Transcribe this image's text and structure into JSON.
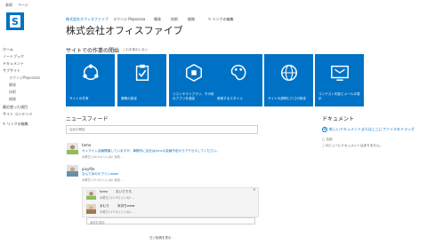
{
  "topbar": {
    "links": [
      "参照",
      "ページ"
    ]
  },
  "logo": {
    "letter": "S"
  },
  "header_nav": [
    {
      "label": "株式会社オフィスファイブ",
      "active": true
    },
    {
      "label": "ラウンジ Pepocoza",
      "active": false
    },
    {
      "label": "開発",
      "active": false
    },
    {
      "label": "技術",
      "active": false
    },
    {
      "label": "総務",
      "active": false
    },
    {
      "label": "リンクの編集",
      "active": false
    }
  ],
  "site_title": "株式会社オフィスファイブ",
  "left_nav": [
    {
      "label": "ホーム",
      "indent": false
    },
    {
      "label": "ノートブック",
      "indent": false
    },
    {
      "label": "ドキュメント",
      "indent": false
    },
    {
      "label": "サブサイト",
      "indent": false
    },
    {
      "label": "ラウンジPepocoza",
      "indent": true
    },
    {
      "label": "開発",
      "indent": true
    },
    {
      "label": "技術",
      "indent": true
    },
    {
      "label": "総務",
      "indent": true
    },
    {
      "label": "最近使った項目",
      "indent": false
    },
    {
      "label": "サイト コンテンツ",
      "indent": false
    },
    {
      "label": "リンクの編集",
      "indent": false
    }
  ],
  "getting_started": {
    "heading": "サイトでの作業の開始",
    "remove_link": "これを表示しない",
    "tiles": [
      {
        "label": "サイトの共有",
        "icon": "share-icon"
      },
      {
        "label": "業務の設定",
        "icon": "clipboard-check-icon"
      },
      {
        "label": "リストやライブラリ、その他のアプリを追加",
        "icon": "add-app-icon"
      },
      {
        "label": "使用するスタイル",
        "icon": "paint-palette-icon"
      },
      {
        "label": "サイトの説明とロゴの設定",
        "icon": "globe-icon"
      },
      {
        "label": "コンテスト内容とメールの表示",
        "icon": "tv-mail-icon"
      }
    ]
  },
  "newsfeed": {
    "heading": "ニュースフィード",
    "input_placeholder": "会話の開始",
    "posts": [
      {
        "author": "tomo",
        "text": "オンライン会議開催していますが、事務所に出社はLyncの会議予定からアクセスしてください。",
        "meta": "水曜日 (10:14)  いいね!  返信  ..."
      },
      {
        "author": "pixyfile",
        "text": "なんであのかプリンwww",
        "meta": "水曜日 (17:41)  いいね!  返信  ..."
      }
    ],
    "replies": [
      {
        "author": "tomo",
        "text": "おいでです。",
        "meta": "水曜日 (11:33)  いいね!  ..."
      },
      {
        "author": "あむろ",
        "text": "気持ちwww",
        "meta": "水曜日 (17:41)  いいね!  ..."
      }
    ],
    "reply_placeholder": "返信を追加",
    "more_link": "古い投稿を表示"
  },
  "documents": {
    "heading": "ドキュメント",
    "new_link": "新しいドキュメントまたはここにファイルをドラッグ",
    "column": "名前",
    "empty_text": "このビューにドキュメントはありません。"
  },
  "colors": {
    "tile_blue": "#0072c6",
    "link_blue": "#0072c6"
  }
}
